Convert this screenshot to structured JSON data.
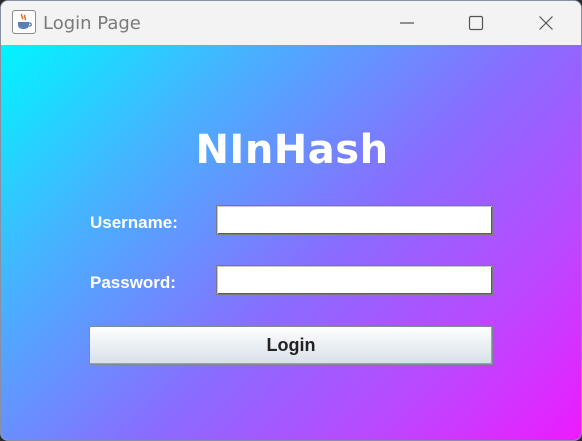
{
  "window": {
    "title": "Login Page",
    "app_icon": "java-cup-icon",
    "controls": {
      "minimize_icon": "minimize-icon",
      "maximize_icon": "maximize-icon",
      "close_icon": "close-icon"
    }
  },
  "login": {
    "heading": "NInHash",
    "username_label": "Username:",
    "username_value": "",
    "password_label": "Password:",
    "password_value": "",
    "login_button_label": "Login"
  },
  "colors": {
    "gradient_start": "#00f5ff",
    "gradient_end": "#ee1aff",
    "text_on_gradient": "#ffffff"
  }
}
